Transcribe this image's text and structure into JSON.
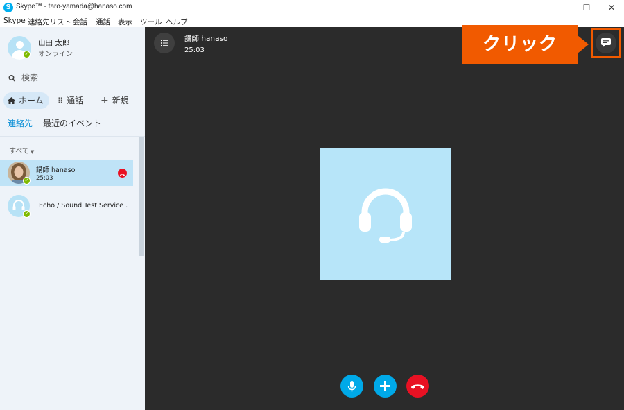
{
  "window": {
    "title": "Skype™ - taro-yamada@hanaso.com",
    "logo_letter": "S",
    "minimize": "—",
    "maximize": "☐",
    "close": "✕"
  },
  "menu": [
    "Skype",
    "連絡先リスト",
    "会話",
    "通話",
    "表示",
    "ツール",
    "ヘルプ"
  ],
  "profile": {
    "name": "山田 太郎",
    "status": "オンライン"
  },
  "search": {
    "placeholder": "検索"
  },
  "nav": {
    "home": "ホーム",
    "call": "通話",
    "new": "新規"
  },
  "subtabs": {
    "contacts": "連絡先",
    "recent": "最近のイベント"
  },
  "filter": {
    "label": "すべて"
  },
  "contacts": [
    {
      "name": "講師 hanaso",
      "sub": "25:03",
      "in_call": true
    },
    {
      "name": "Echo / Sound Test Service ."
    }
  ],
  "call": {
    "title": "講師 hanaso",
    "time": "25:03"
  },
  "annotation": {
    "label": "クリック",
    "color": "#f15a00"
  },
  "colors": {
    "accent": "#00a9e8",
    "hangup": "#e81123",
    "online": "#7fba00",
    "tile": "#b7e5f9"
  }
}
